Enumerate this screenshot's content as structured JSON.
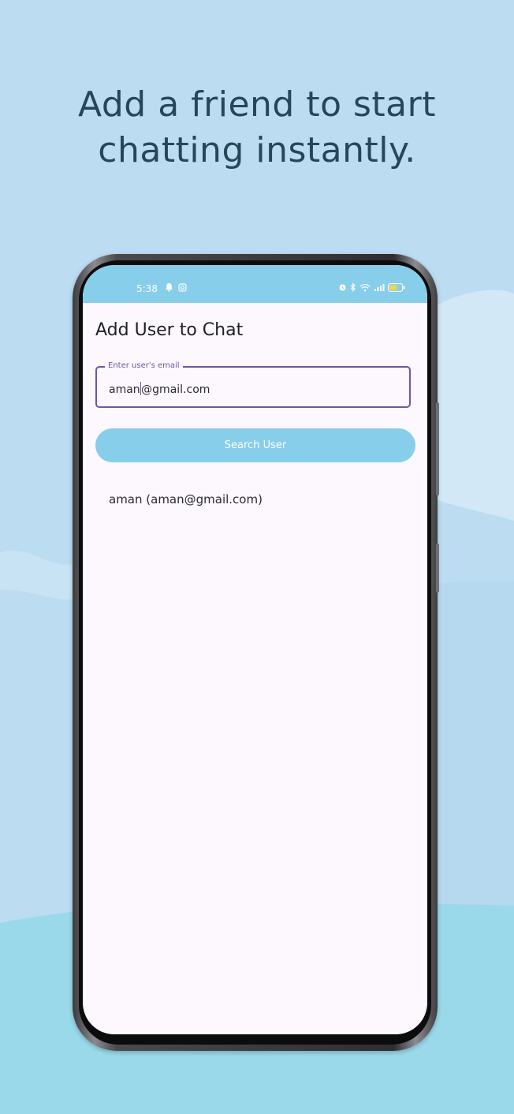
{
  "headline": {
    "line1": "Add a friend to start",
    "line2": "chatting instantly."
  },
  "status_bar": {
    "time": "5:38",
    "left_icons": [
      "notification-bell-icon",
      "instagram-icon"
    ],
    "right_icons": [
      "alarm-icon",
      "bluetooth-icon",
      "wifi-icon",
      "signal-icon",
      "battery-icon"
    ],
    "color": "#87ceeb"
  },
  "screen": {
    "title": "Add User to Chat",
    "email_field": {
      "label": "Enter user's email",
      "value_before_caret": "aman",
      "value_after_caret": "@gmail.com"
    },
    "search_button": {
      "label": "Search User"
    },
    "results": [
      {
        "label": "aman (aman@gmail.com)"
      }
    ]
  },
  "colors": {
    "accent": "#6f56a8",
    "primary": "#87ceeb",
    "background": "#bcdcf1",
    "headline": "#26475a"
  }
}
